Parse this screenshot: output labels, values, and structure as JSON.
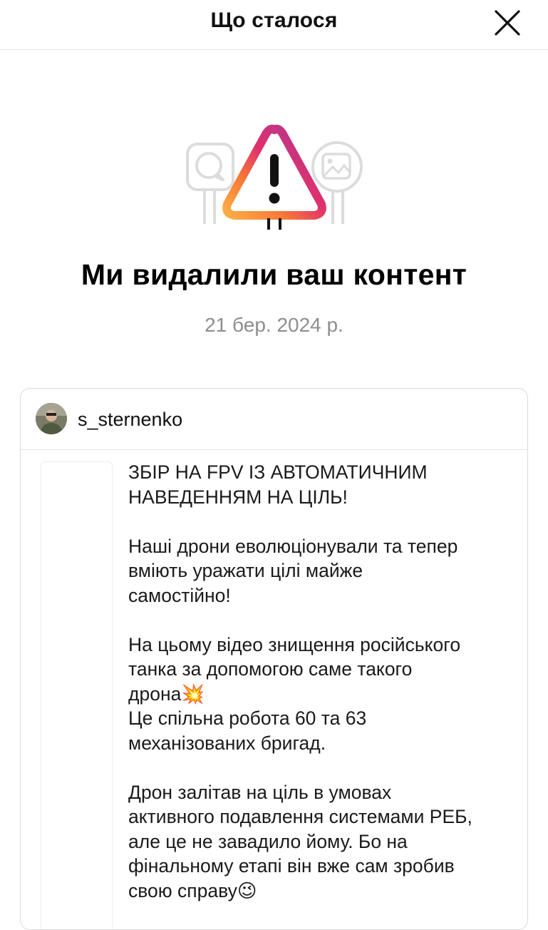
{
  "header": {
    "title": "Що сталося",
    "close_icon": "close-icon"
  },
  "illustration": {
    "icon": "warning-triangle-icon",
    "left_icon": "comment-bubble-icon",
    "right_icon": "image-icon",
    "gradient": [
      "#8a3ab9",
      "#e1306c",
      "#fd1d1d",
      "#f77737",
      "#fcaf45"
    ]
  },
  "main": {
    "headline": "Ми видалили ваш контент",
    "date": "21 бер. 2024 р."
  },
  "post": {
    "username": "s_sternenko",
    "paragraphs": [
      [
        "ЗБІР НА FPV ІЗ АВТОМАТИЧНИМ",
        "НАВЕДЕННЯМ НА ЦІЛЬ!"
      ],
      [
        "Наші дрони еволюціонували та тепер",
        "вміють уражати цілі майже",
        "самостійно!"
      ],
      [
        "На цьому відео знищення російського",
        "танка за допомогою саме такого",
        "дрона💥",
        "Це спільна робота 60 та 63",
        "механізованих бригад."
      ],
      [
        "Дрон залітав на ціль в умовах",
        "активного подавлення системами РЕБ,",
        "але це не завадило йому. Бо на",
        "фінальному етапі він вже сам зробив",
        "свою справу😉"
      ]
    ]
  }
}
